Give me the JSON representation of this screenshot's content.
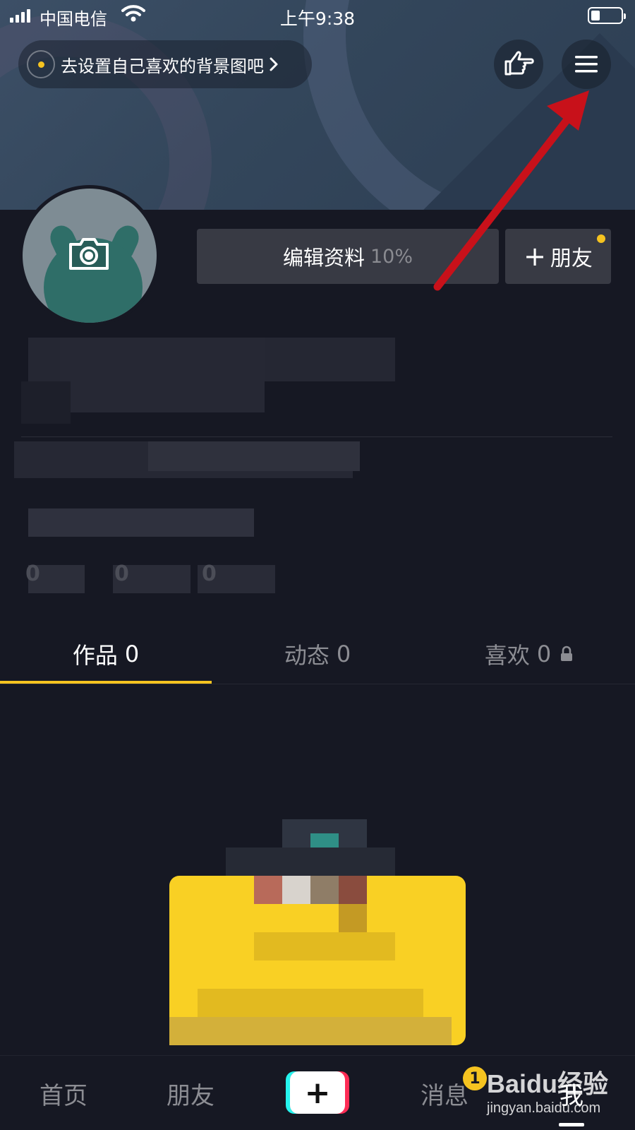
{
  "status_bar": {
    "carrier": "中国电信",
    "time": "上午9:38"
  },
  "header": {
    "background_prompt": "去设置自己喜欢的背景图吧",
    "hand_icon": "pointing-hand-icon",
    "menu_icon": "hamburger-menu-icon"
  },
  "profile": {
    "edit_label": "编辑资料",
    "edit_progress": "10%",
    "add_friend_label": "朋友",
    "stats": [
      "0",
      "0",
      "0"
    ]
  },
  "tabs": [
    {
      "label": "作品",
      "count": "0",
      "active": true
    },
    {
      "label": "动态",
      "count": "0",
      "active": false
    },
    {
      "label": "喜欢",
      "count": "0",
      "active": false,
      "locked": true
    }
  ],
  "bottom_nav": {
    "home": "首页",
    "friends": "朋友",
    "plus": "+",
    "messages": "消息",
    "messages_badge": "1",
    "me": "我"
  },
  "watermark": {
    "brand": "Baidu经验",
    "url": "jingyan.baidu.com"
  },
  "colors": {
    "accent": "#f5c320",
    "background": "#161823",
    "button": "#383a44",
    "arrow": "#c8111a",
    "tiktok_cyan": "#25f4ee",
    "tiktok_red": "#fe2c55"
  }
}
